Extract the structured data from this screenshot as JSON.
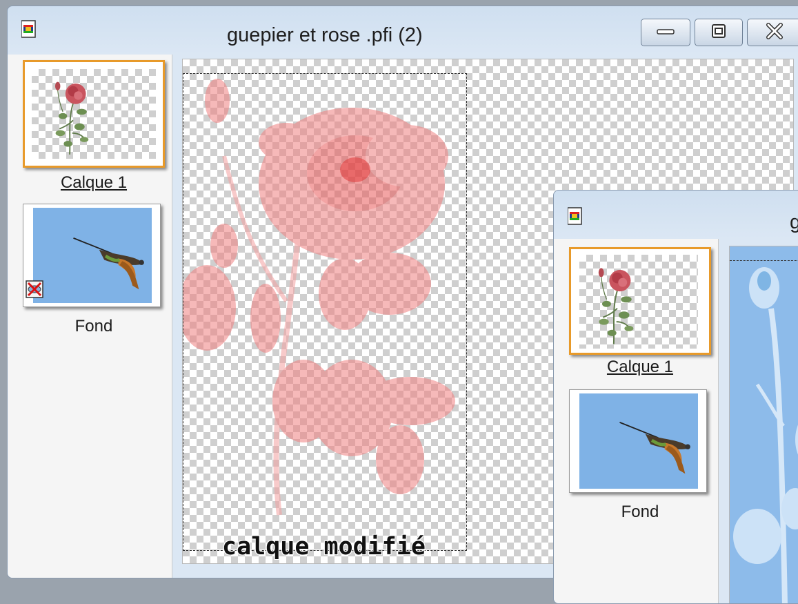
{
  "main_window": {
    "title": "guepier et rose  .pfi (2)",
    "icon": "film-document-icon",
    "controls": {
      "minimize": "minimize-icon",
      "restore": "restore-icon",
      "close": "close-icon"
    },
    "layers": [
      {
        "name": "Calque 1",
        "selected": true,
        "content": "rose"
      },
      {
        "name": "Fond",
        "selected": false,
        "content": "bird-on-sky",
        "badge": "hidden-layer-icon"
      }
    ]
  },
  "second_window": {
    "title": "g",
    "icon": "film-document-icon",
    "layers": [
      {
        "name": "Calque 1",
        "selected": true,
        "content": "rose"
      },
      {
        "name": "Fond",
        "selected": false,
        "content": "bird-on-sky"
      }
    ]
  },
  "caption": "calque modifié",
  "colors": {
    "selection_border": "#e89a2a",
    "sky": "#7fb2e6",
    "rose_faded": "#f08080",
    "titlebar": "#dbe7f4"
  }
}
